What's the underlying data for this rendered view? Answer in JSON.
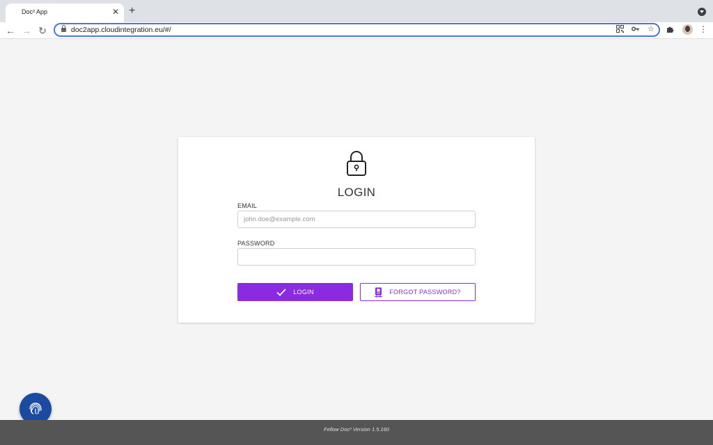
{
  "browser": {
    "tab_title": "Doc² App",
    "tab_close": "✕",
    "new_tab": "+",
    "url": "doc2app.cloudintegration.eu/#/",
    "nav": {
      "back": "←",
      "forward": "→",
      "reload": "↻"
    },
    "icons": [
      "qr-code-icon",
      "key-icon",
      "star-icon",
      "extensions-icon",
      "avatar",
      "menu-icon"
    ]
  },
  "login": {
    "title": "LOGIN",
    "email_label": "EMAIL",
    "email_placeholder": "john.doe@example.com",
    "email_value": "",
    "password_label": "PASSWORD",
    "password_value": "",
    "login_button": "LOGIN",
    "forgot_button": "FORGOT PASSWORD?"
  },
  "footer": {
    "text": "Fellow Doc² Version 1.5.160"
  },
  "colors": {
    "accent": "#8a2be2",
    "fab": "#1b4ba1",
    "footer": "#555555",
    "omnibox_border": "#4a78d6"
  }
}
